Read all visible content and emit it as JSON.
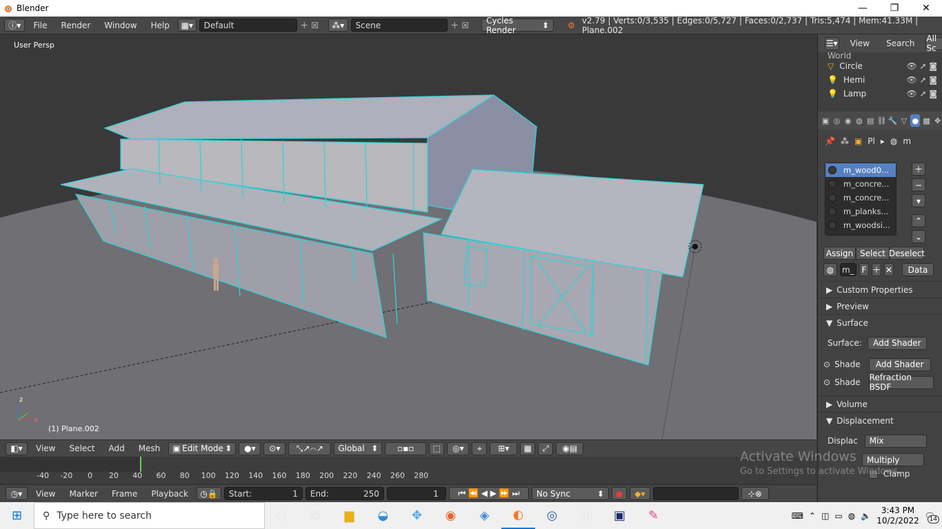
{
  "window": {
    "title": "Blender",
    "minimize": "—",
    "maximize": "❐",
    "close": "✕"
  },
  "info_header": {
    "menus": [
      "File",
      "Render",
      "Window",
      "Help"
    ],
    "layout": "Default",
    "scene": "Scene",
    "engine": "Cycles Render",
    "stats": "v2.79 | Verts:0/3,535 | Edges:0/5,727 | Faces:0/2,737 | Tris:5,474 | Mem:41.33M | Plane.002"
  },
  "viewport": {
    "label": "User Persp",
    "object": "(1) Plane.002",
    "axis_z": "z",
    "axis_x": "x"
  },
  "view3d_header": {
    "menus": [
      "View",
      "Select",
      "Add",
      "Mesh"
    ],
    "mode": "Edit Mode",
    "orientation": "Global"
  },
  "timeline": {
    "ticks": [
      "-40",
      "-20",
      "0",
      "20",
      "40",
      "60",
      "80",
      "100",
      "120",
      "140",
      "160",
      "180",
      "200",
      "220",
      "240",
      "260",
      "280"
    ],
    "menus": [
      "View",
      "Marker",
      "Frame",
      "Playback"
    ],
    "start_label": "Start:",
    "start": "1",
    "end_label": "End:",
    "end": "250",
    "current": "1",
    "sync": "No Sync"
  },
  "outliner": {
    "menus": [
      "View",
      "Search"
    ],
    "filter": "All Sc",
    "top_item": "World",
    "items": [
      "Circle",
      "Hemi",
      "Lamp"
    ]
  },
  "properties": {
    "breadcrumb": [
      "Pl",
      "m"
    ],
    "slots": [
      "m_wood0...",
      "m_concre...",
      "m_concre...",
      "m_planks...",
      "m_woodsi..."
    ],
    "assign": "Assign",
    "select": "Select",
    "deselect": "Deselect",
    "mat_name": "m_",
    "fake": "F",
    "data": "Data",
    "panels": {
      "custom": "Custom Properties",
      "preview": "Preview",
      "surface": "Surface",
      "surface_label": "Surface:",
      "add_shader": "Add Shader",
      "shade1": "Shade",
      "shade1_val": "Add Shader",
      "shade2": "Shade",
      "shade2_val": "Refraction BSDF",
      "volume": "Volume",
      "displacement": "Displacement",
      "displac": "Displac",
      "mix": "Mix",
      "multiply": "Multiply",
      "clamp": "Clamp"
    }
  },
  "watermark": {
    "line1": "Activate Windows",
    "line2": "Go to Settings to activate Windows."
  },
  "taskbar": {
    "search": "Type here to search",
    "time": "3:43 PM",
    "date": "10/2/2022",
    "badge": "14"
  }
}
